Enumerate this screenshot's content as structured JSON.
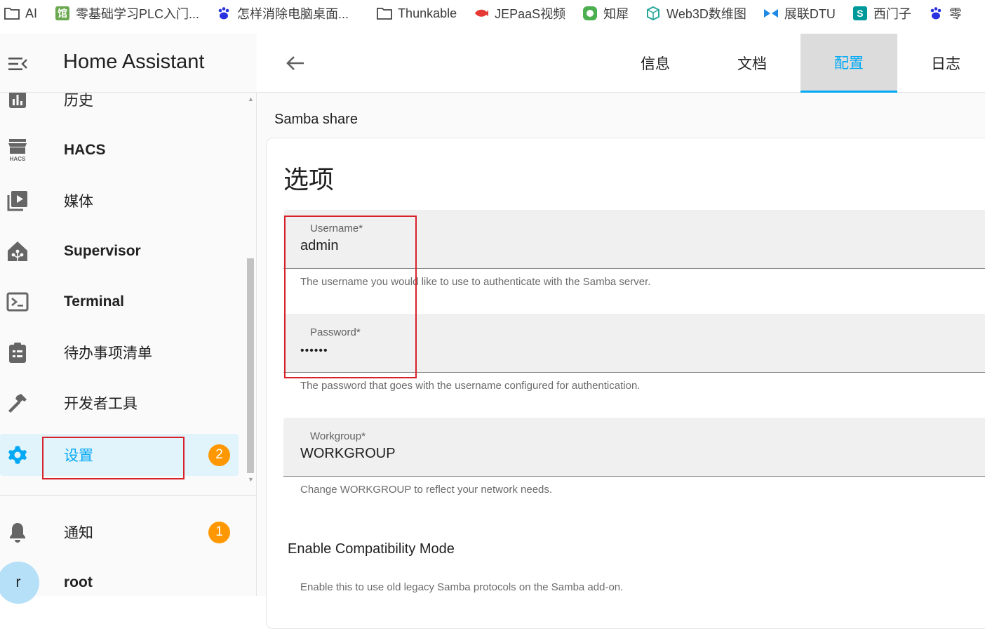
{
  "bookmarks": [
    {
      "label": "AI",
      "icon": "folder-icon"
    },
    {
      "label": "零基础学习PLC入门...",
      "icon": "site-logo-icon",
      "glyph": "馆",
      "color": "#6aa84f"
    },
    {
      "label": "怎样消除电脑桌面...",
      "icon": "baidu-paw-icon",
      "color": "#2932e1"
    },
    {
      "label": "Thunkable",
      "icon": "folder-icon"
    },
    {
      "label": "JEPaaS视频",
      "icon": "site-logo-icon",
      "color": "#e53935"
    },
    {
      "label": "知犀",
      "icon": "site-logo-icon",
      "color": "#4caf50"
    },
    {
      "label": "Web3D数维图",
      "icon": "cube-icon",
      "color": "#26a69a"
    },
    {
      "label": "展联DTU",
      "icon": "site-logo-icon",
      "color": "#1e88e5"
    },
    {
      "label": "西门子",
      "icon": "site-logo-icon",
      "glyph": "S",
      "color": "#009999"
    },
    {
      "label": "零",
      "icon": "baidu-paw-icon",
      "color": "#2932e1"
    }
  ],
  "sidebar": {
    "title": "Home Assistant",
    "items": [
      {
        "label": "历史",
        "icon": "chart-icon",
        "bold": false
      },
      {
        "label": "HACS",
        "icon": "hacs-icon",
        "bold": true
      },
      {
        "label": "媒体",
        "icon": "media-icon",
        "bold": false
      },
      {
        "label": "Supervisor",
        "icon": "supervisor-icon",
        "bold": true
      },
      {
        "label": "Terminal",
        "icon": "terminal-icon",
        "bold": true
      },
      {
        "label": "待办事项清单",
        "icon": "clipboard-list-icon",
        "bold": false
      },
      {
        "label": "开发者工具",
        "icon": "hammer-icon",
        "bold": false
      },
      {
        "label": "设置",
        "icon": "gear-icon",
        "bold": false,
        "active": true,
        "badge": "2"
      }
    ],
    "notifications": {
      "label": "通知",
      "badge": "1"
    },
    "user": {
      "label": "root",
      "initial": "r"
    }
  },
  "tabs": [
    {
      "label": "信息"
    },
    {
      "label": "文档"
    },
    {
      "label": "配置",
      "active": true
    },
    {
      "label": "日志"
    }
  ],
  "main": {
    "section_title": "Samba share",
    "card_title": "选项",
    "fields": [
      {
        "label": "Username*",
        "value": "admin",
        "helper": "The username you would like to use to authenticate with the Samba server."
      },
      {
        "label": "Password*",
        "value": "••••••",
        "helper": "The password that goes with the username configured for authentication."
      },
      {
        "label": "Workgroup*",
        "value": "WORKGROUP",
        "helper": "Change WORKGROUP to reflect your network needs."
      }
    ],
    "compat": {
      "title": "Enable Compatibility Mode",
      "helper": "Enable this to use old legacy Samba protocols on the Samba add-on."
    }
  },
  "colors": {
    "accent": "#03a9f4",
    "badge": "#ff9800",
    "highlight": "#d7222b"
  }
}
